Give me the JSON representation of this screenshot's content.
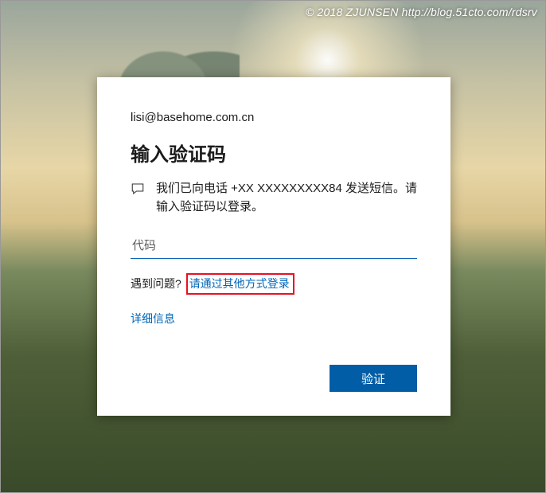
{
  "watermark": "© 2018 ZJUNSEN http://blog.51cto.com/rdsrv",
  "card": {
    "identity": "lisi@basehome.com.cn",
    "title": "输入验证码",
    "message": "我们已向电话 +XX XXXXXXXXX84 发送短信。请输入验证码以登录。",
    "code_placeholder": "代码",
    "code_value": "",
    "trouble_label": "遇到问题?",
    "other_way_link": "请通过其他方式登录",
    "more_info_link": "详细信息",
    "verify_button": "验证"
  },
  "colors": {
    "accent": "#005da6",
    "link": "#0067b8",
    "highlight_border": "#e81123"
  }
}
